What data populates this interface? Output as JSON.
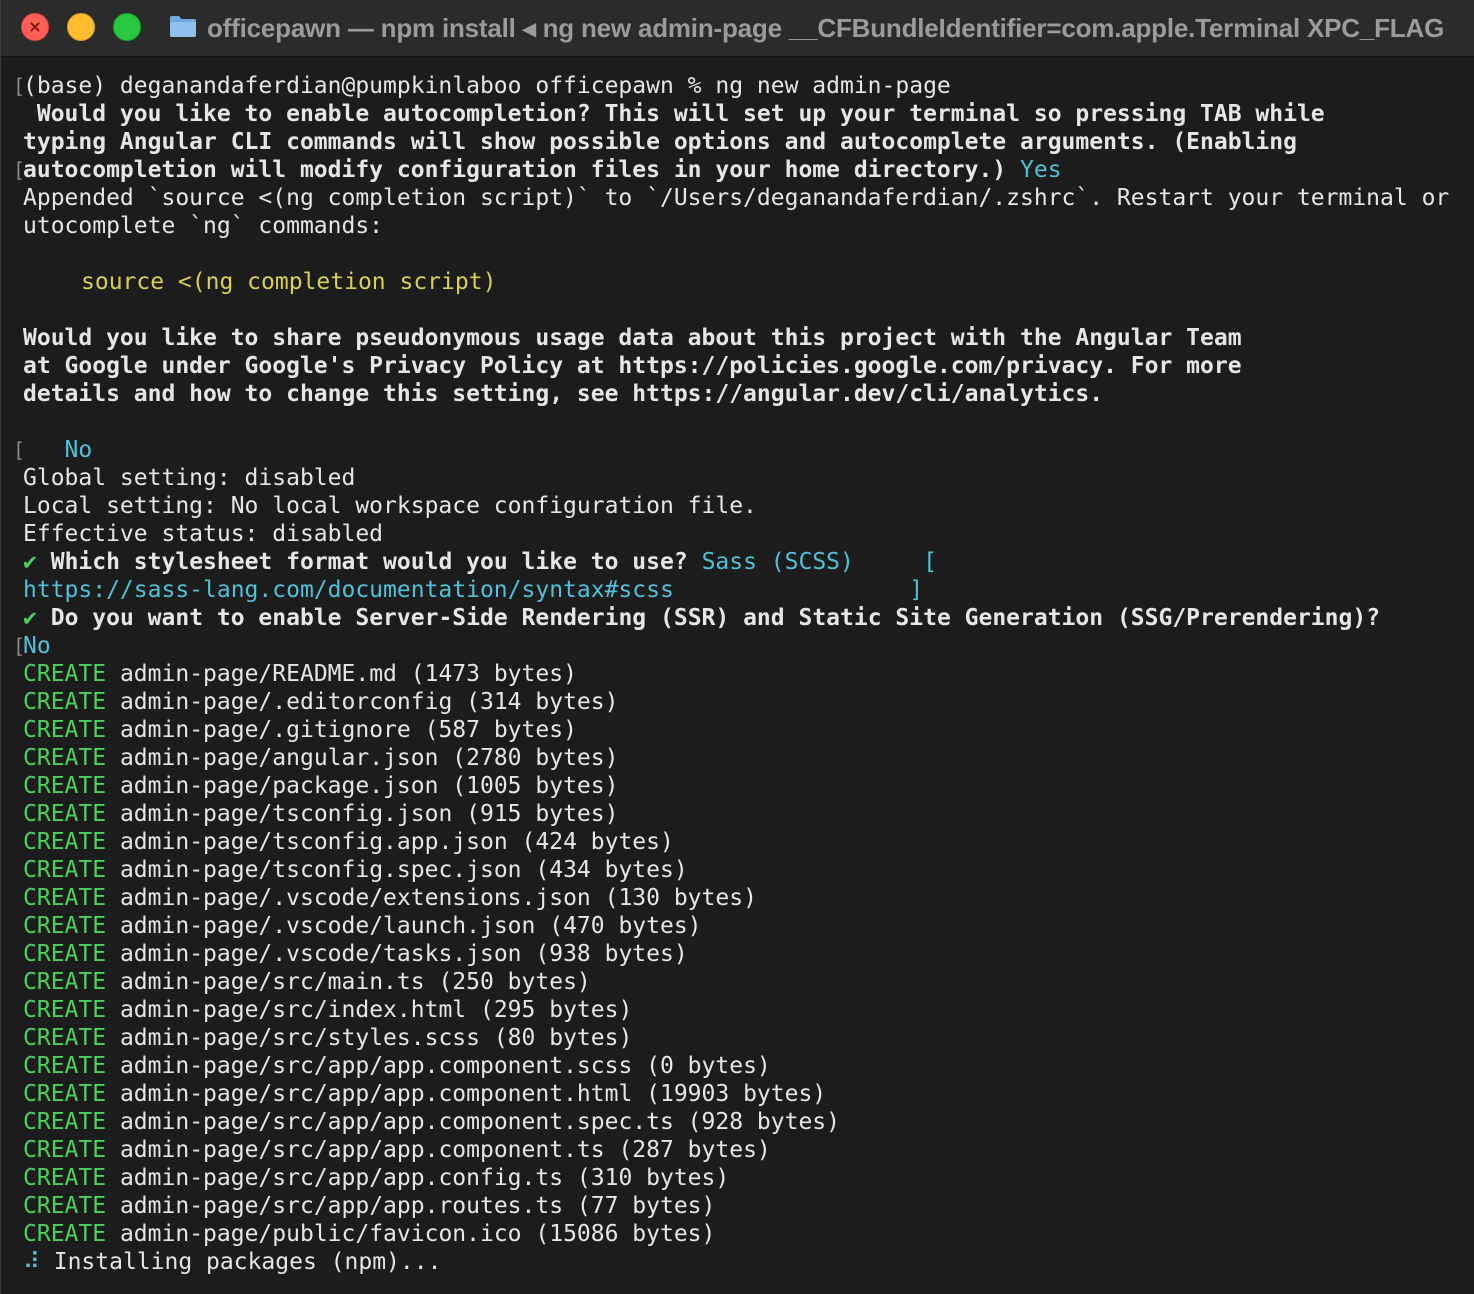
{
  "window": {
    "title": "officepawn — npm install ◂ ng new admin-page __CFBundleIdentifier=com.apple.Terminal XPC_FLAG",
    "controls": [
      "close",
      "minimize",
      "zoom"
    ],
    "icon": "folder-icon"
  },
  "terminal": {
    "prompt_line": "(base) deganandaferdian@pumpkinlaboo officepawn % ng new admin-page",
    "q1_line1": " Would you like to enable autocompletion? This will set up your terminal so pressing TAB while",
    "q1_line2": "typing Angular CLI commands will show possible options and autocomplete arguments. (Enabling",
    "q1_line3": "autocompletion will modify configuration files in your home directory.)",
    "q1_answer": "Yes",
    "appended_line1": "Appended `source <(ng completion script)` to `/Users/deganandaferdian/.zshrc`. Restart your terminal or",
    "appended_line2": "utocomplete `ng` commands:",
    "source_cmd": "source <(ng completion script)",
    "q2_line1": "Would you like to share pseudonymous usage data about this project with the Angular Team",
    "q2_line2": "at Google under Google's Privacy Policy at https://policies.google.com/privacy. For more",
    "q2_line3": "details and how to change this setting, see https://angular.dev/cli/analytics.",
    "q2_answer": "No",
    "global_setting": "Global setting: disabled",
    "local_setting": "Local setting: No local workspace configuration file.",
    "effective_status": "Effective status: disabled",
    "checkmark": "✔",
    "q3_text": "Which stylesheet format would you like to use?",
    "q3_answer": "Sass (SCSS)",
    "q3_bracket_open": "[",
    "q3_url": "https://sass-lang.com/documentation/syntax#scss",
    "q3_bracket_close": "]",
    "q4_text": "Do you want to enable Server-Side Rendering (SSR) and Static Site Generation (SSG/Prerendering)?",
    "q4_answer": "No",
    "line_markers": [
      "[",
      "[",
      "[",
      "["
    ],
    "create_label": "CREATE",
    "created_files": [
      "admin-page/README.md (1473 bytes)",
      "admin-page/.editorconfig (314 bytes)",
      "admin-page/.gitignore (587 bytes)",
      "admin-page/angular.json (2780 bytes)",
      "admin-page/package.json (1005 bytes)",
      "admin-page/tsconfig.json (915 bytes)",
      "admin-page/tsconfig.app.json (424 bytes)",
      "admin-page/tsconfig.spec.json (434 bytes)",
      "admin-page/.vscode/extensions.json (130 bytes)",
      "admin-page/.vscode/launch.json (470 bytes)",
      "admin-page/.vscode/tasks.json (938 bytes)",
      "admin-page/src/main.ts (250 bytes)",
      "admin-page/src/index.html (295 bytes)",
      "admin-page/src/styles.scss (80 bytes)",
      "admin-page/src/app/app.component.scss (0 bytes)",
      "admin-page/src/app/app.component.html (19903 bytes)",
      "admin-page/src/app/app.component.spec.ts (928 bytes)",
      "admin-page/src/app/app.component.ts (287 bytes)",
      "admin-page/src/app/app.config.ts (310 bytes)",
      "admin-page/src/app/app.routes.ts (77 bytes)",
      "admin-page/public/favicon.ico (15086 bytes)"
    ],
    "spinner": "⠼",
    "installing": "Installing packages (npm)..."
  }
}
